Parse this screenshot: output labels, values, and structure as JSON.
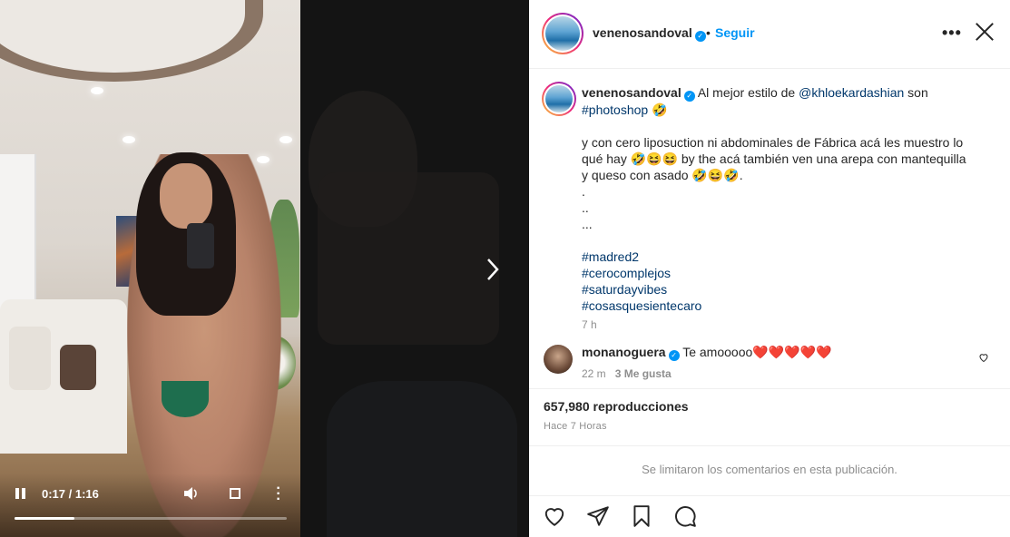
{
  "post": {
    "username": "venenosandoval",
    "separator": "•",
    "follow_label": "Seguir",
    "more_label": "•••",
    "caption": {
      "intro": "Al mejor estilo de ",
      "mention": "@khloekardashian",
      "after_mention": " son",
      "hashtag_photoshop": "#photoshop",
      "emoji_rofl": "🤣",
      "body": "y con cero liposuction ni abdominales de Fábrica acá les muestro lo qué hay 🤣😆😆 by the acá también ven una arepa con mantequilla y queso con asado 🤣😆🤣.",
      "dots": ".\n..\n...",
      "hashtags": [
        "#madred2",
        "#cerocomplejos",
        "#saturdayvibes",
        "#cosasquesientecaro"
      ],
      "time": "7 h"
    },
    "comment": {
      "username": "monanoguera",
      "text": "Te amooooo❤️❤️❤️❤️❤️",
      "time": "22 m",
      "likes": "3 Me gusta"
    },
    "views": "657,980 reproducciones",
    "posted_ago": "Hace 7 Horas",
    "comments_limited": "Se limitaron los comentarios en esta publicación."
  },
  "video": {
    "time_display": "0:17 / 1:16",
    "progress": 0.22
  },
  "colors": {
    "accent": "#0095f6",
    "link": "#00376b",
    "muted": "#8e8e8e"
  },
  "icons": [
    "pause-icon",
    "volume-icon",
    "fullscreen-icon",
    "more-vertical-icon",
    "next-arrow-icon",
    "close-icon",
    "heart-icon",
    "share-icon",
    "bookmark-icon",
    "comment-icon",
    "verified-icon"
  ]
}
